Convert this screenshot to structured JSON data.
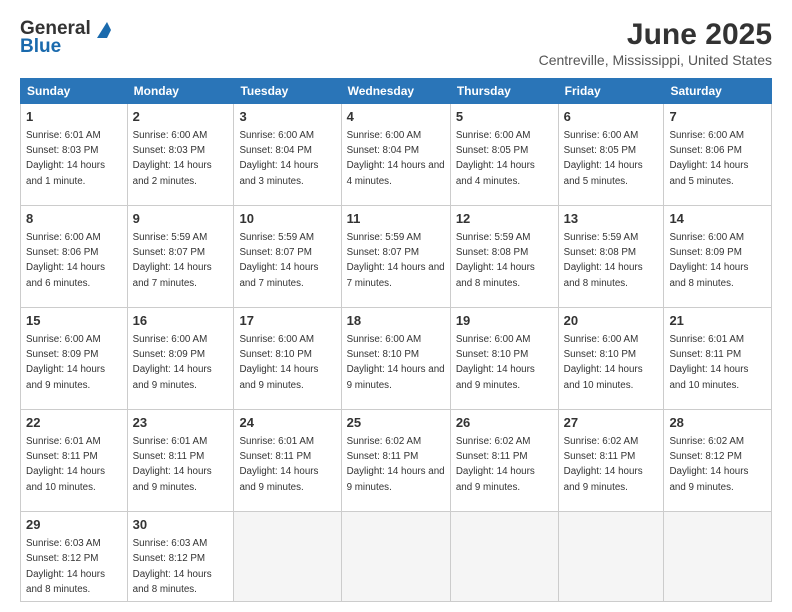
{
  "logo": {
    "general": "General",
    "blue": "Blue"
  },
  "header": {
    "month": "June 2025",
    "location": "Centreville, Mississippi, United States"
  },
  "days_of_week": [
    "Sunday",
    "Monday",
    "Tuesday",
    "Wednesday",
    "Thursday",
    "Friday",
    "Saturday"
  ],
  "weeks": [
    [
      {
        "day": "1",
        "sunrise": "6:01 AM",
        "sunset": "8:03 PM",
        "daylight": "14 hours and 1 minute."
      },
      {
        "day": "2",
        "sunrise": "6:00 AM",
        "sunset": "8:03 PM",
        "daylight": "14 hours and 2 minutes."
      },
      {
        "day": "3",
        "sunrise": "6:00 AM",
        "sunset": "8:04 PM",
        "daylight": "14 hours and 3 minutes."
      },
      {
        "day": "4",
        "sunrise": "6:00 AM",
        "sunset": "8:04 PM",
        "daylight": "14 hours and 4 minutes."
      },
      {
        "day": "5",
        "sunrise": "6:00 AM",
        "sunset": "8:05 PM",
        "daylight": "14 hours and 4 minutes."
      },
      {
        "day": "6",
        "sunrise": "6:00 AM",
        "sunset": "8:05 PM",
        "daylight": "14 hours and 5 minutes."
      },
      {
        "day": "7",
        "sunrise": "6:00 AM",
        "sunset": "8:06 PM",
        "daylight": "14 hours and 5 minutes."
      }
    ],
    [
      {
        "day": "8",
        "sunrise": "6:00 AM",
        "sunset": "8:06 PM",
        "daylight": "14 hours and 6 minutes."
      },
      {
        "day": "9",
        "sunrise": "5:59 AM",
        "sunset": "8:07 PM",
        "daylight": "14 hours and 7 minutes."
      },
      {
        "day": "10",
        "sunrise": "5:59 AM",
        "sunset": "8:07 PM",
        "daylight": "14 hours and 7 minutes."
      },
      {
        "day": "11",
        "sunrise": "5:59 AM",
        "sunset": "8:07 PM",
        "daylight": "14 hours and 7 minutes."
      },
      {
        "day": "12",
        "sunrise": "5:59 AM",
        "sunset": "8:08 PM",
        "daylight": "14 hours and 8 minutes."
      },
      {
        "day": "13",
        "sunrise": "5:59 AM",
        "sunset": "8:08 PM",
        "daylight": "14 hours and 8 minutes."
      },
      {
        "day": "14",
        "sunrise": "6:00 AM",
        "sunset": "8:09 PM",
        "daylight": "14 hours and 8 minutes."
      }
    ],
    [
      {
        "day": "15",
        "sunrise": "6:00 AM",
        "sunset": "8:09 PM",
        "daylight": "14 hours and 9 minutes."
      },
      {
        "day": "16",
        "sunrise": "6:00 AM",
        "sunset": "8:09 PM",
        "daylight": "14 hours and 9 minutes."
      },
      {
        "day": "17",
        "sunrise": "6:00 AM",
        "sunset": "8:10 PM",
        "daylight": "14 hours and 9 minutes."
      },
      {
        "day": "18",
        "sunrise": "6:00 AM",
        "sunset": "8:10 PM",
        "daylight": "14 hours and 9 minutes."
      },
      {
        "day": "19",
        "sunrise": "6:00 AM",
        "sunset": "8:10 PM",
        "daylight": "14 hours and 9 minutes."
      },
      {
        "day": "20",
        "sunrise": "6:00 AM",
        "sunset": "8:10 PM",
        "daylight": "14 hours and 10 minutes."
      },
      {
        "day": "21",
        "sunrise": "6:01 AM",
        "sunset": "8:11 PM",
        "daylight": "14 hours and 10 minutes."
      }
    ],
    [
      {
        "day": "22",
        "sunrise": "6:01 AM",
        "sunset": "8:11 PM",
        "daylight": "14 hours and 10 minutes."
      },
      {
        "day": "23",
        "sunrise": "6:01 AM",
        "sunset": "8:11 PM",
        "daylight": "14 hours and 9 minutes."
      },
      {
        "day": "24",
        "sunrise": "6:01 AM",
        "sunset": "8:11 PM",
        "daylight": "14 hours and 9 minutes."
      },
      {
        "day": "25",
        "sunrise": "6:02 AM",
        "sunset": "8:11 PM",
        "daylight": "14 hours and 9 minutes."
      },
      {
        "day": "26",
        "sunrise": "6:02 AM",
        "sunset": "8:11 PM",
        "daylight": "14 hours and 9 minutes."
      },
      {
        "day": "27",
        "sunrise": "6:02 AM",
        "sunset": "8:11 PM",
        "daylight": "14 hours and 9 minutes."
      },
      {
        "day": "28",
        "sunrise": "6:02 AM",
        "sunset": "8:12 PM",
        "daylight": "14 hours and 9 minutes."
      }
    ],
    [
      {
        "day": "29",
        "sunrise": "6:03 AM",
        "sunset": "8:12 PM",
        "daylight": "14 hours and 8 minutes."
      },
      {
        "day": "30",
        "sunrise": "6:03 AM",
        "sunset": "8:12 PM",
        "daylight": "14 hours and 8 minutes."
      },
      null,
      null,
      null,
      null,
      null
    ]
  ]
}
